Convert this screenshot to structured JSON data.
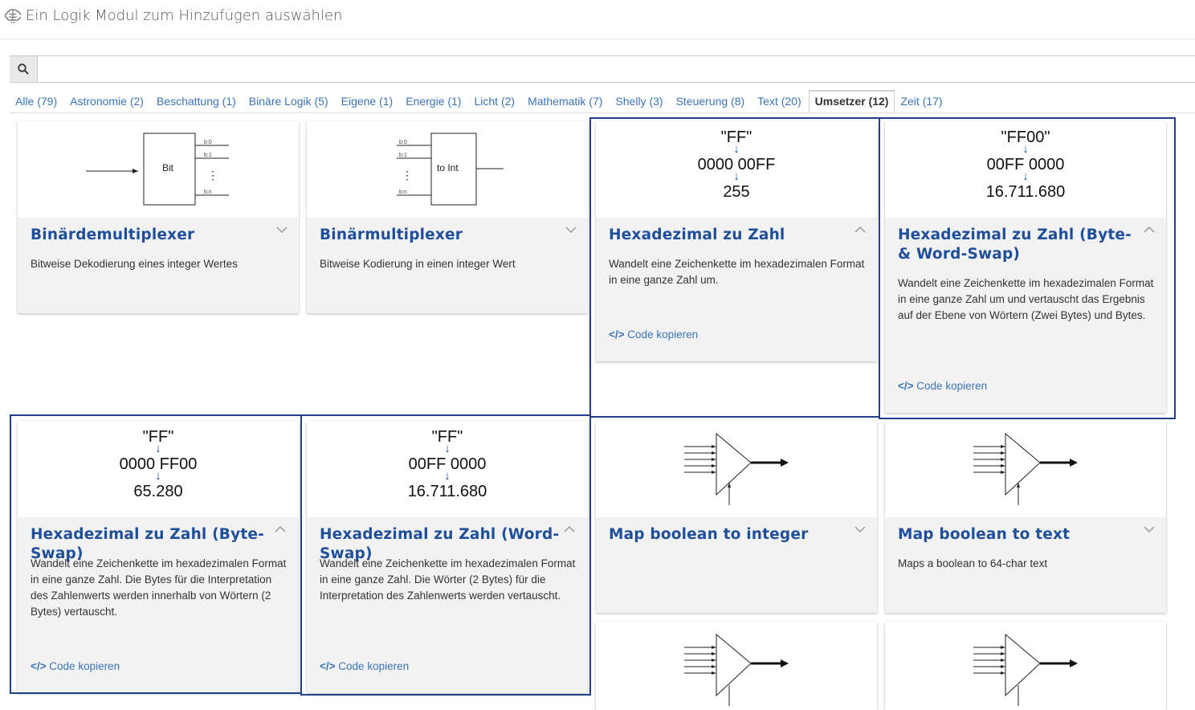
{
  "header": {
    "title": "Ein Logik Modul zum Hinzufügen auswählen",
    "icon": "brain-icon"
  },
  "search": {
    "value": "",
    "placeholder": ""
  },
  "tabs": [
    {
      "label": "Alle (79)"
    },
    {
      "label": "Astronomie (2)"
    },
    {
      "label": "Beschattung (1)"
    },
    {
      "label": "Binäre Logik (5)"
    },
    {
      "label": "Eigene (1)"
    },
    {
      "label": "Energie (1)"
    },
    {
      "label": "Licht (2)"
    },
    {
      "label": "Mathematik (7)"
    },
    {
      "label": "Shelly (3)"
    },
    {
      "label": "Steuerung (8)"
    },
    {
      "label": "Text (20)"
    },
    {
      "label": "Umsetzer (12)",
      "active": true
    },
    {
      "label": "Zeit (17)"
    }
  ],
  "cards": [
    {
      "title": "Binärdemultiplexer",
      "desc": "Bitweise Dekodierung eines integer Wertes",
      "diagram": {
        "box": "Bit",
        "labels": [
          "b:0",
          "b:1",
          "⋮",
          "b:n"
        ]
      },
      "expanded": false
    },
    {
      "title": "Binärmultiplexer",
      "desc": "Bitweise Kodierung in einen integer Wert",
      "diagram": {
        "box": "to Int",
        "labels": [
          "b:0",
          "b:1",
          "⋮",
          "b:n"
        ]
      },
      "expanded": false
    },
    {
      "title": "Hexadezimal zu Zahl",
      "desc": "Wandelt eine Zeichenkette im hexadezimalen Format in eine ganze Zahl um.",
      "hex": [
        "\"FF\"",
        "0000 00FF",
        "255"
      ],
      "code": "Code kopieren",
      "expanded": true
    },
    {
      "title": "Hexadezimal zu Zahl (Byte- & Word-Swap)",
      "desc": "Wandelt eine Zeichenkette im hexadezimalen Format in eine ganze Zahl um und vertauscht das Ergebnis auf der Ebene von Wörtern (Zwei Bytes) und Bytes.",
      "hex": [
        "\"FF00\"",
        "00FF 0000",
        "16.711.680"
      ],
      "code": "Code kopieren",
      "expanded": true
    },
    {
      "title": "Hexadezimal zu Zahl (Byte-Swap)",
      "desc": "Wandelt eine Zeichenkette im hexadezimalen Format in eine ganze Zahl. Die Bytes für die Interpretation des Zahlenwerts werden innerhalb von Wörtern (2 Bytes) vertauscht.",
      "hex": [
        "\"FF\"",
        "0000 FF00",
        "65.280"
      ],
      "code": "Code kopieren",
      "expanded": true
    },
    {
      "title": "Hexadezimal zu Zahl (Word-Swap)",
      "desc": "Wandelt eine Zeichenkette im hexadezimalen Format in eine ganze Zahl. Die Wörter (2 Bytes) für die Interpretation des Zahlenwerts werden vertauscht.",
      "hex": [
        "\"FF\"",
        "00FF 0000",
        "16.711.680"
      ],
      "code": "Code kopieren",
      "expanded": true
    },
    {
      "title": "Map boolean to integer",
      "desc": "",
      "expanded": false
    },
    {
      "title": "Map boolean to text",
      "desc": "Maps a boolean to 64-char text",
      "expanded": false
    }
  ],
  "colors": {
    "link": "#3b74b8",
    "title": "#1f4e9a",
    "highlight": "#1f3f8f"
  }
}
